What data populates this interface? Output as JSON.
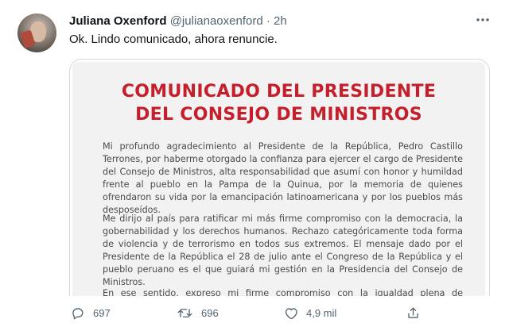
{
  "tweet": {
    "author_name": "Juliana Oxenford",
    "handle": "@julianaoxenford",
    "separator": "·",
    "time": "2h",
    "text": "Ok. Lindo comunicado, ahora renuncie."
  },
  "document": {
    "title_line1": "COMUNICADO DEL PRESIDENTE",
    "title_line2": "DEL CONSEJO DE MINISTROS",
    "paragraph1": "Mi profundo agradecimiento al Presidente de la República, Pedro Castillo Terrones, por haberme otorgado la confianza para ejercer el cargo de Presidente del Consejo de Ministros, alta responsabilidad que asumí con honor y humildad frente al pueblo en la Pampa de la Quinua, por la memoria de quienes ofrendaron su vida por la emancipación latinoamericana y por los pueblos más desposeídos.",
    "paragraph2": "Me dirijo al país para ratificar mi más firme compromiso con la democracia, la gobernabilidad y los derechos humanos. Rechazo categóricamente toda forma de violencia y de terrorismo en todos sus extremos. El mensaje dado por el Presidente de la República el 28 de julio ante el Congreso de la República y el pueblo peruano es el que guiará mi gestión en la Presidencia del Consejo de Ministros.",
    "paragraph3": "En ese sentido, expreso mi firme compromiso con la igualdad plena de derechos. Como"
  },
  "actions": {
    "replies": "697",
    "retweets": "696",
    "likes": "4,9 mil"
  },
  "icons": {
    "more": "more-horizontal-icon",
    "reply": "reply-icon",
    "retweet": "retweet-icon",
    "like": "heart-icon",
    "share": "share-icon"
  },
  "colors": {
    "doc_title": "#c41f2b",
    "muted": "#536471"
  }
}
